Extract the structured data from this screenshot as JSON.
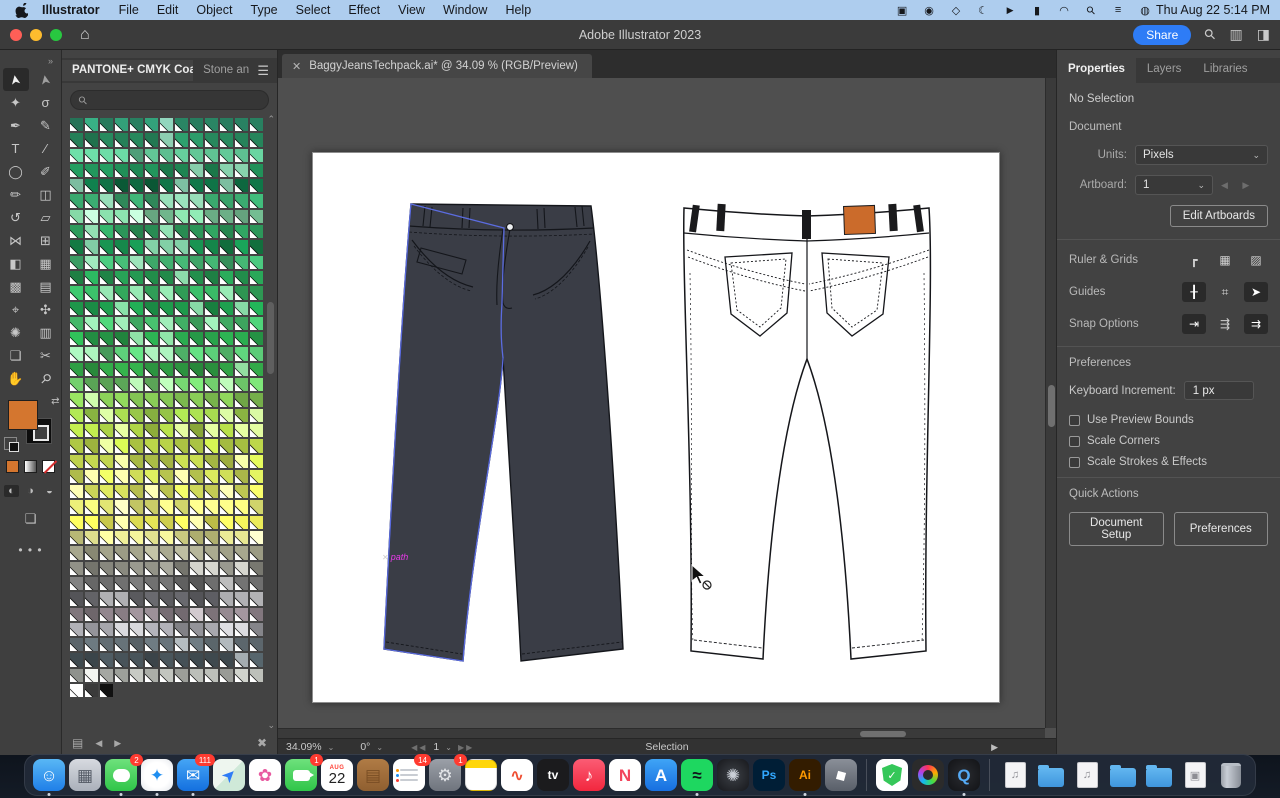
{
  "menu_bar": {
    "app_name": "Illustrator",
    "items": [
      "File",
      "Edit",
      "Object",
      "Type",
      "Select",
      "Effect",
      "View",
      "Window",
      "Help"
    ],
    "status_icons": [
      {
        "name": "app-status-icon",
        "glyph": "▣"
      },
      {
        "name": "screen-record-status-icon",
        "glyph": "◉"
      },
      {
        "name": "shield-status-icon",
        "glyph": "◇"
      },
      {
        "name": "focus-moon-icon",
        "glyph": "☾"
      },
      {
        "name": "playback-status-icon",
        "glyph": "▶"
      },
      {
        "name": "battery-icon",
        "glyph": "▮"
      },
      {
        "name": "wifi-icon",
        "glyph": "◠"
      },
      {
        "name": "spotlight-icon",
        "glyph": "⚲"
      },
      {
        "name": "control-center-icon",
        "glyph": "≡"
      },
      {
        "name": "siri-icon",
        "glyph": "◍"
      }
    ],
    "clock": "Thu Aug 22  5:14 PM"
  },
  "title_bar": {
    "title": "Adobe Illustrator 2023",
    "share_label": "Share"
  },
  "document_tab": {
    "close": "✕",
    "label": "BaggyJeansTechpack.ai* @ 34.09 % (RGB/Preview)"
  },
  "toolbar": {
    "tools": [
      {
        "name": "selection-tool",
        "glyph": "➤",
        "rot": "rot-n100",
        "active": true
      },
      {
        "name": "direct-selection-tool",
        "glyph": "➤",
        "rot": "rot-n100",
        "outline": true
      },
      {
        "name": "magic-wand-tool",
        "glyph": "✦"
      },
      {
        "name": "lasso-tool",
        "glyph": "σ"
      },
      {
        "name": "pen-tool",
        "glyph": "✒"
      },
      {
        "name": "curvature-tool",
        "glyph": "✎"
      },
      {
        "name": "type-tool",
        "glyph": "T"
      },
      {
        "name": "line-segment-tool",
        "glyph": "∕"
      },
      {
        "name": "ellipse-tool",
        "glyph": "◯"
      },
      {
        "name": "paintbrush-tool",
        "glyph": "✐"
      },
      {
        "name": "pencil-tool",
        "glyph": "✏"
      },
      {
        "name": "eraser-tool",
        "glyph": "◫"
      },
      {
        "name": "rotate-tool",
        "glyph": "↺"
      },
      {
        "name": "scale-tool",
        "glyph": "▱"
      },
      {
        "name": "width-tool",
        "glyph": "⋈"
      },
      {
        "name": "free-transform-tool",
        "glyph": "⊞"
      },
      {
        "name": "shape-builder-tool",
        "glyph": "◧"
      },
      {
        "name": "perspective-grid-tool",
        "glyph": "▦"
      },
      {
        "name": "mesh-tool",
        "glyph": "▩"
      },
      {
        "name": "gradient-tool",
        "glyph": "▤"
      },
      {
        "name": "eyedropper-tool",
        "glyph": "⌖"
      },
      {
        "name": "blend-tool",
        "glyph": "✣"
      },
      {
        "name": "symbol-sprayer-tool",
        "glyph": "✺"
      },
      {
        "name": "column-graph-tool",
        "glyph": "▥"
      },
      {
        "name": "artboard-tool",
        "glyph": "❏"
      },
      {
        "name": "slice-tool",
        "glyph": "✂"
      },
      {
        "name": "hand-tool",
        "glyph": "✋"
      },
      {
        "name": "zoom-tool",
        "glyph": "⚲",
        "rot": "rot-45"
      }
    ],
    "fill_color": "#d4762f",
    "ellipsis": "• • •"
  },
  "swatches_panel": {
    "tab_active": "PANTONE+ CMYK Coated",
    "tab_inactive": "Stone an",
    "menu_icon": "☰",
    "search_icon": "⚲",
    "columns": 13,
    "row_colors": [
      "#2f9470",
      "#27885d",
      "#5dbd8f",
      "#1f8a55",
      "#0e6e43",
      "#38a36b",
      "#7fce9f",
      "#2fa05f",
      "#168a4c",
      "#41ae6e",
      "#27a055",
      "#36b061",
      "#1f9e4e",
      "#45b96a",
      "#2aa84e",
      "#58c473",
      "#2f9e44",
      "#6fc96a",
      "#86c855",
      "#9bcb4a",
      "#aacf45",
      "#bdd84a",
      "#cade52",
      "#d7e65c",
      "#e3ec62",
      "#eef27a",
      "#f0f05a",
      "#d9d98a",
      "#a8a88f",
      "#8f8f85",
      "#6f6f6f",
      "#5a5a5e",
      "#8a7f86",
      "#9a9aa0",
      "#5f6a70",
      "#4a565c",
      "#b7bab4"
    ],
    "special_row": [
      "#ffffff",
      "#3a3a3a",
      "#111111"
    ],
    "footer_icons": {
      "library": "▤",
      "prev": "◀",
      "next": "▶",
      "no_edit": "✖"
    }
  },
  "canvas": {
    "smart_guide_label": "path",
    "selection_color": "#5b6ce0",
    "front_jeans_fill": "#3a3d46",
    "back_patch_color": "#cb6b2b"
  },
  "status_bar": {
    "zoom": "34.09%",
    "rotation": "0°",
    "artboard": "1",
    "mode": "Selection"
  },
  "properties_panel": {
    "tabs": [
      "Properties",
      "Layers",
      "Libraries"
    ],
    "selection_status": "No Selection",
    "document": {
      "title": "Document",
      "units_label": "Units:",
      "units_value": "Pixels",
      "artboard_label": "Artboard:",
      "artboard_value": "1",
      "edit_artboards_label": "Edit Artboards"
    },
    "icon_groups": [
      {
        "label": "Ruler & Grids",
        "icons": [
          {
            "name": "ruler-corner-icon",
            "glyph": "┏",
            "active": false
          },
          {
            "name": "grid-icon",
            "glyph": "▦",
            "active": false
          },
          {
            "name": "transparency-grid-icon",
            "glyph": "▨",
            "active": false
          }
        ]
      },
      {
        "label": "Guides",
        "icons": [
          {
            "name": "show-guides-icon",
            "glyph": "╂",
            "active": true
          },
          {
            "name": "lock-guides-icon",
            "glyph": "⌗",
            "active": false
          },
          {
            "name": "smart-guides-icon",
            "glyph": "➤",
            "active": true
          }
        ]
      },
      {
        "label": "Snap Options",
        "icons": [
          {
            "name": "snap-to-grid-icon",
            "glyph": "⇥",
            "active": true
          },
          {
            "name": "snap-to-pixel-icon",
            "glyph": "⇶",
            "active": false
          },
          {
            "name": "snap-to-point-icon",
            "glyph": "⇉",
            "active": true
          }
        ]
      }
    ],
    "preferences": {
      "title": "Preferences",
      "keyboard_increment_label": "Keyboard Increment:",
      "keyboard_increment_value": "1 px",
      "checkboxes": [
        "Use Preview Bounds",
        "Scale Corners",
        "Scale Strokes & Effects"
      ]
    },
    "quick_actions": {
      "title": "Quick Actions",
      "buttons": [
        "Document Setup",
        "Preferences"
      ]
    }
  },
  "dock": {
    "items": [
      {
        "name": "finder",
        "kind": "glyph",
        "bg": "linear-gradient(180deg,#59b7f5,#1f7fe8)",
        "glyph": "☺",
        "fg": "#ffffff",
        "running": true
      },
      {
        "name": "launchpad",
        "kind": "glyph",
        "bg": "linear-gradient(180deg,#d7dae0,#aab0ba)",
        "glyph": "▦",
        "fg": "#555b66"
      },
      {
        "name": "messages",
        "kind": "bubble",
        "bg": "linear-gradient(180deg,#6ee17c,#2fc549)",
        "badge": "2",
        "running": true
      },
      {
        "name": "safari",
        "kind": "glyph",
        "bg": "radial-gradient(circle,#ffffff 55%,#e4e7ec)",
        "glyph": "✦",
        "fg": "#1f8ef0",
        "running": true
      },
      {
        "name": "mail",
        "kind": "glyph",
        "bg": "linear-gradient(180deg,#45a5f5,#1470df)",
        "glyph": "✉",
        "fg": "#ffffff",
        "badge": "111",
        "running": true
      },
      {
        "name": "maps",
        "kind": "glyph",
        "bg": "linear-gradient(135deg,#eef6ef 50%,#cfe9d8 50%)",
        "glyph": "➤",
        "fg": "#2f7cf6",
        "rot": "rot-n45"
      },
      {
        "name": "photos",
        "kind": "glyph",
        "bg": "#ffffff",
        "glyph": "✿",
        "fg": "#e85aa0"
      },
      {
        "name": "facetime",
        "kind": "camera",
        "bg": "linear-gradient(180deg,#6ee17c,#2fc549)",
        "badge": "1"
      },
      {
        "name": "calendar",
        "kind": "calendar",
        "bg": "#ffffff",
        "top": "AUG",
        "num": "22"
      },
      {
        "name": "address-book",
        "kind": "glyph",
        "bg": "linear-gradient(180deg,#b07b45,#8f5f30)",
        "glyph": "▤",
        "fg": "#7a4e24"
      },
      {
        "name": "reminders",
        "kind": "list",
        "bg": "#ffffff",
        "badge": "14"
      },
      {
        "name": "system-settings",
        "kind": "glyph",
        "bg": "linear-gradient(180deg,#9ba0a8,#6f747d)",
        "glyph": "⚙",
        "fg": "#e3e5e8",
        "badge": "1"
      },
      {
        "name": "notes",
        "kind": "note",
        "bg": "transparent"
      },
      {
        "name": "fitness",
        "kind": "glyph",
        "bg": "#ffffff",
        "glyph": "∿",
        "fg": "#ef4f33",
        "bold": true
      },
      {
        "name": "apple-tv",
        "kind": "glyph",
        "bg": "#1b1b1d",
        "glyph": "tv",
        "fg": "#ffffff",
        "small": true,
        "bold": true
      },
      {
        "name": "music",
        "kind": "glyph",
        "bg": "linear-gradient(180deg,#fb5c74,#f2273e)",
        "glyph": "♪",
        "fg": "#ffffff"
      },
      {
        "name": "news",
        "kind": "glyph",
        "bg": "#ffffff",
        "glyph": "N",
        "fg": "#f2455c",
        "bold": true
      },
      {
        "name": "app-store",
        "kind": "glyph",
        "bg": "linear-gradient(180deg,#3fa4f6,#176fe0)",
        "glyph": "A",
        "fg": "#ffffff",
        "bold": true
      },
      {
        "name": "spotify",
        "kind": "glyph",
        "bg": "#1ed760",
        "glyph": "≈",
        "fg": "#10131a",
        "bold": true,
        "running": true
      },
      {
        "name": "photo-booth",
        "kind": "glyph",
        "bg": "radial-gradient(circle,#3c4046,#17181c)",
        "glyph": "✺",
        "fg": "#c9ced6"
      },
      {
        "name": "photoshop",
        "kind": "glyph",
        "bg": "#001e36",
        "glyph": "Ps",
        "fg": "#31a8ff",
        "small": true,
        "bold": true
      },
      {
        "name": "illustrator",
        "kind": "glyph",
        "bg": "#331c00",
        "glyph": "Ai",
        "fg": "#ff9a00",
        "small": true,
        "bold": true,
        "running": true
      },
      {
        "name": "roblox",
        "kind": "glyph",
        "bg": "linear-gradient(180deg,#8a8f98,#595f69)",
        "glyph": "■",
        "fg": "#ffffff",
        "rot": "rot-15"
      },
      {
        "name": "dock-separator-1",
        "kind": "sep"
      },
      {
        "name": "adguard",
        "kind": "shield",
        "bg": "#ffffff",
        "check": "✓"
      },
      {
        "name": "creative-cloud",
        "kind": "cc",
        "bg": "#2b2b2b"
      },
      {
        "name": "quicktime",
        "kind": "glyph",
        "bg": "radial-gradient(circle,#2a2c31,#121316)",
        "glyph": "Q",
        "fg": "#55aaf5",
        "bold": true,
        "running": true
      },
      {
        "name": "dock-separator-2",
        "kind": "sep"
      },
      {
        "name": "file-music-1",
        "kind": "page",
        "glyph": "♫"
      },
      {
        "name": "folder-open",
        "kind": "folder"
      },
      {
        "name": "file-music-2",
        "kind": "page",
        "glyph": "♫"
      },
      {
        "name": "folder-1",
        "kind": "folder"
      },
      {
        "name": "folder-2",
        "kind": "folder"
      },
      {
        "name": "file-image",
        "kind": "page",
        "glyph": "▣"
      },
      {
        "name": "trash",
        "kind": "trash"
      }
    ]
  }
}
